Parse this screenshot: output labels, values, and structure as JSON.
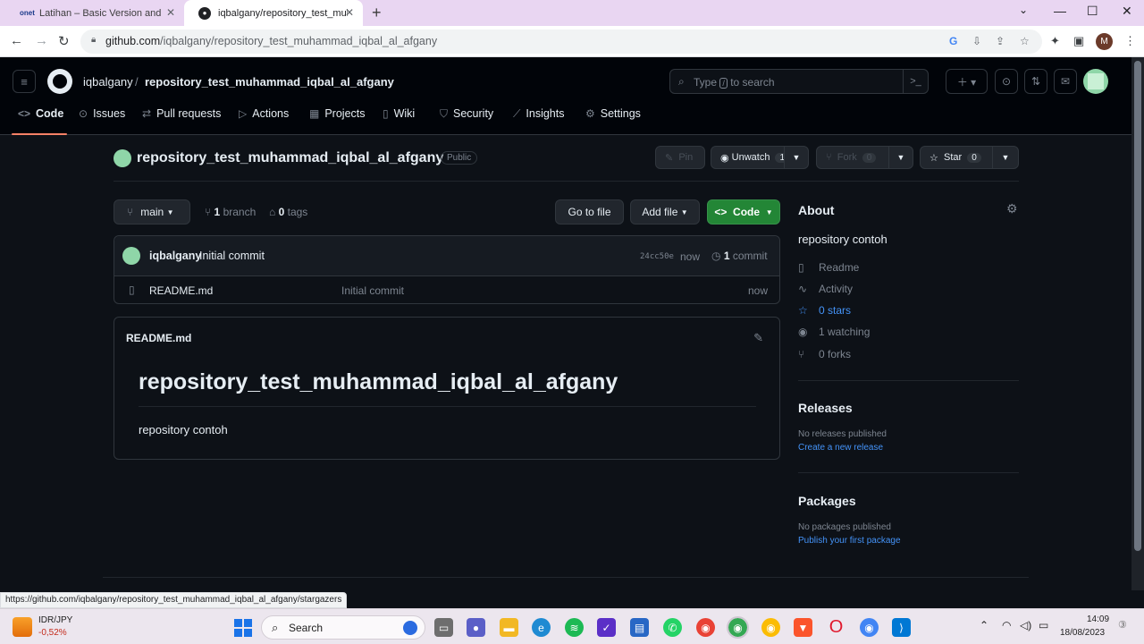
{
  "browser": {
    "tabs": [
      {
        "title": "Latihan – Basic Version and Branch",
        "favicon": "onet"
      },
      {
        "title": "iqbalgany/repository_test_muhammad",
        "favicon": "github"
      }
    ],
    "new_tab": "+",
    "url_host": "github.com",
    "url_path": "/iqbalgany/repository_test_muhammad_iqbal_al_afgany",
    "profile_initial": "M"
  },
  "header": {
    "owner": "iqbalgany",
    "separator": "/",
    "repo": "repository_test_muhammad_iqbal_al_afgany",
    "search_prefix": "Type",
    "search_key": "/",
    "search_suffix": "to search",
    "nav": [
      {
        "label": "Code"
      },
      {
        "label": "Issues"
      },
      {
        "label": "Pull requests"
      },
      {
        "label": "Actions"
      },
      {
        "label": "Projects"
      },
      {
        "label": "Wiki"
      },
      {
        "label": "Security"
      },
      {
        "label": "Insights"
      },
      {
        "label": "Settings"
      }
    ]
  },
  "repo": {
    "name": "repository_test_muhammad_iqbal_al_afgany",
    "visibility": "Public",
    "pin": "Pin",
    "unwatch": "Unwatch",
    "watch_count": "1",
    "fork": "Fork",
    "fork_count": "0",
    "star": "Star",
    "star_count": "0",
    "branch": "main",
    "branch_count": "1",
    "branch_word": "branch",
    "tags_count": "0",
    "tags_word": "tags",
    "go_to_file": "Go to file",
    "add_file": "Add file",
    "code": "Code"
  },
  "commit": {
    "author": "iqbalgany",
    "message": "Initial commit",
    "sha": "24cc50e",
    "time": "now",
    "count": "1",
    "count_word": "commit"
  },
  "files": [
    {
      "name": "README.md",
      "message": "Initial commit",
      "time": "now"
    }
  ],
  "readme": {
    "filename": "README.md",
    "heading": "repository_test_muhammad_iqbal_al_afgany",
    "body": "repository contoh"
  },
  "about": {
    "title": "About",
    "description": "repository contoh",
    "readme": "Readme",
    "activity": "Activity",
    "stars": "0 stars",
    "watching": "1 watching",
    "forks": "0 forks"
  },
  "releases": {
    "title": "Releases",
    "empty": "No releases published",
    "link": "Create a new release"
  },
  "packages": {
    "title": "Packages",
    "empty": "No packages published",
    "link": "Publish your first package"
  },
  "status_url": "https://github.com/iqbalgany/repository_test_muhammad_iqbal_al_afgany/stargazers",
  "taskbar": {
    "stock_name": "IDR/JPY",
    "stock_change": "-0,52%",
    "search_label": "Search",
    "time": "14:09",
    "date": "18/08/2023"
  },
  "colors": {
    "bg": "#0d1117",
    "header_bg": "#010409",
    "accent_underline": "#f78166",
    "code_button": "#238636",
    "link": "#4493f8",
    "tab_strip": "#e9d6f2"
  }
}
